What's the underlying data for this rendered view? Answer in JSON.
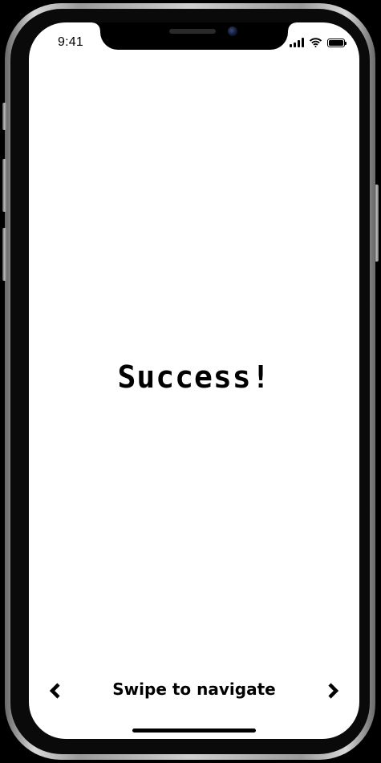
{
  "status_bar": {
    "time": "9:41",
    "icons": [
      "cellular-signal-icon",
      "wifi-icon",
      "battery-icon"
    ],
    "battery_level": 1.0
  },
  "main": {
    "headline": "Success!"
  },
  "navigation": {
    "hint": "Swipe to navigate",
    "prev_icon": "chevron-left-icon",
    "next_icon": "chevron-right-icon"
  },
  "colors": {
    "screen_background": "#ffffff",
    "text": "#000000",
    "device_body": "#000000"
  }
}
